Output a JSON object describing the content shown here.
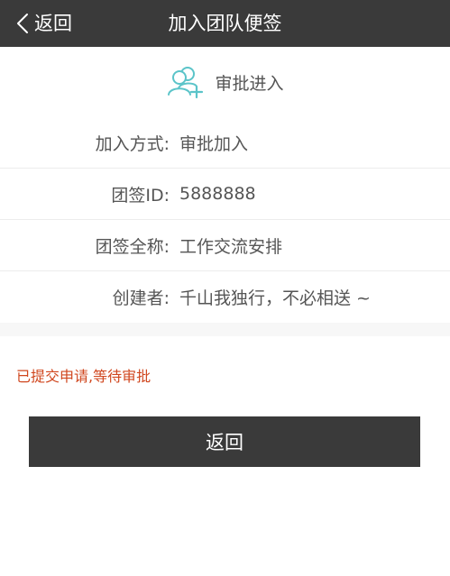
{
  "header": {
    "back_label": "返回",
    "title": "加入团队便签",
    "back_icon": "chevron-left-icon"
  },
  "approval": {
    "icon": "add-group-icon",
    "title": "审批进入",
    "icon_color": "#5bc4c9"
  },
  "info_rows": [
    {
      "label": "加入方式:",
      "value": "审批加入"
    },
    {
      "label": "团签ID:",
      "value": "5888888"
    },
    {
      "label": "团签全称:",
      "value": "工作交流安排"
    },
    {
      "label": "创建者:",
      "value": "千山我独行，不必相送 ~"
    }
  ],
  "status": {
    "text": "已提交申请,等待审批",
    "color": "#d0471f"
  },
  "footer": {
    "return_label": "返回"
  },
  "colors": {
    "topbar": "#3a3a3a",
    "button": "#3a3a3a"
  }
}
